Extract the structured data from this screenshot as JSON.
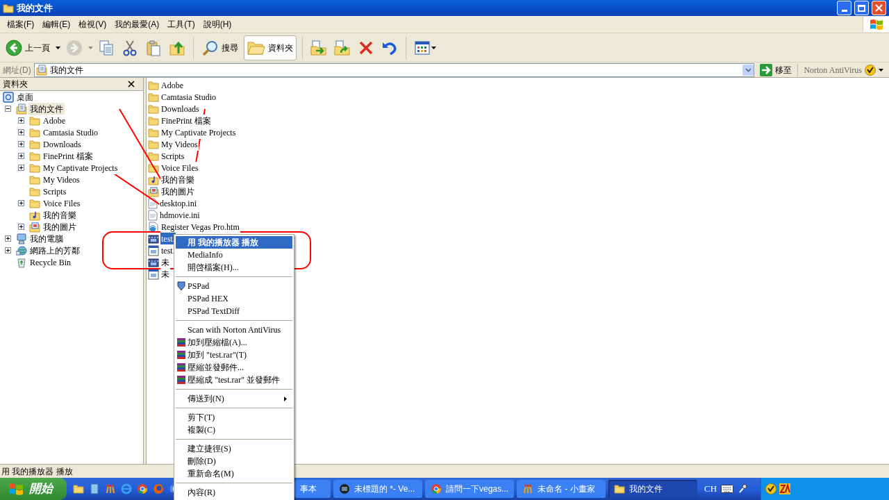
{
  "window": {
    "title": "我的文件"
  },
  "menu_bar": [
    {
      "label": "檔案(F)"
    },
    {
      "label": "編輯(E)"
    },
    {
      "label": "檢視(V)"
    },
    {
      "label": "我的最愛(A)"
    },
    {
      "label": "工具(T)"
    },
    {
      "label": "說明(H)"
    }
  ],
  "toolbar": {
    "back": {
      "label": "上一頁"
    },
    "forward": {
      "disabled": true
    },
    "search": {
      "label": "搜尋"
    },
    "folders": {
      "label": "資料夾",
      "selected": true
    }
  },
  "address_bar": {
    "label": "網址(D)",
    "value": "我的文件",
    "go_button": "移至",
    "norton": "Norton AntiVirus"
  },
  "folder_pane": {
    "title": "資料夾",
    "tree": [
      {
        "label": "桌面",
        "expandable": false,
        "expanded": true,
        "selected": false,
        "children": [
          {
            "label": "我的文件",
            "expandable": true,
            "expanded": true,
            "selected": true,
            "children": [
              {
                "label": "Adobe",
                "expandable": true,
                "expanded": false,
                "selected": false
              },
              {
                "label": "Camtasia Studio",
                "expandable": true,
                "expanded": false,
                "selected": false
              },
              {
                "label": "Downloads",
                "expandable": true,
                "expanded": false,
                "selected": false
              },
              {
                "label": "FinePrint 檔案",
                "expandable": true,
                "expanded": false,
                "selected": false
              },
              {
                "label": "My Captivate Projects",
                "expandable": true,
                "expanded": false,
                "selected": false
              },
              {
                "label": "My Videos",
                "expandable": false,
                "expanded": false,
                "selected": false
              },
              {
                "label": "Scripts",
                "expandable": false,
                "expanded": false,
                "selected": false
              },
              {
                "label": "Voice Files",
                "expandable": true,
                "expanded": false,
                "selected": false
              },
              {
                "label": "我的音樂",
                "expandable": false,
                "expanded": false,
                "selected": false
              },
              {
                "label": "我的圖片",
                "expandable": true,
                "expanded": false,
                "selected": false
              }
            ]
          },
          {
            "label": "我的電腦",
            "expandable": true,
            "expanded": false,
            "selected": false
          },
          {
            "label": "網路上的芳鄰",
            "expandable": true,
            "expanded": false,
            "selected": false
          },
          {
            "label": "Recycle Bin",
            "expandable": false,
            "expanded": false,
            "selected": false
          }
        ]
      }
    ]
  },
  "file_list": [
    {
      "name": "Adobe",
      "selected": false
    },
    {
      "name": "Camtasia Studio",
      "selected": false
    },
    {
      "name": "Downloads",
      "selected": false
    },
    {
      "name": "FinePrint 檔案",
      "selected": false
    },
    {
      "name": "My Captivate Projects",
      "selected": false
    },
    {
      "name": "My Videos",
      "selected": false
    },
    {
      "name": "Scripts",
      "selected": false
    },
    {
      "name": "Voice Files",
      "selected": false
    },
    {
      "name": "我的音樂",
      "selected": false
    },
    {
      "name": "我的圖片",
      "selected": false
    },
    {
      "name": "desktop.ini",
      "selected": false
    },
    {
      "name": "hdmovie.ini",
      "selected": false
    },
    {
      "name": "Register Vegas Pro.htm",
      "selected": false
    },
    {
      "name": "test.",
      "selected": true
    },
    {
      "name": "test.",
      "selected": false
    },
    {
      "name": "未",
      "selected": false
    },
    {
      "name": "未",
      "selected": false
    }
  ],
  "context_menu": [
    {
      "kind": "item",
      "label": "用 我的播放器 播放",
      "default": true,
      "selected": true
    },
    {
      "kind": "item",
      "label": "MediaInfo",
      "selected": false
    },
    {
      "kind": "item",
      "label": "開啓檔案(H)...",
      "selected": false
    },
    {
      "kind": "separator"
    },
    {
      "kind": "item",
      "label": "PSPad",
      "selected": false
    },
    {
      "kind": "item",
      "label": "PSPad HEX",
      "selected": false
    },
    {
      "kind": "item",
      "label": "PSPad TextDiff",
      "selected": false
    },
    {
      "kind": "separator"
    },
    {
      "kind": "item",
      "label": "Scan with Norton AntiVirus",
      "selected": false
    },
    {
      "kind": "item",
      "label": "加到壓縮檔(A)...",
      "selected": false
    },
    {
      "kind": "item",
      "label": "加到 \"test.rar\"(T)",
      "selected": false
    },
    {
      "kind": "item",
      "label": "壓縮並發郵件...",
      "selected": false
    },
    {
      "kind": "item",
      "label": "壓縮成 \"test.rar\" 並發郵件",
      "selected": false
    },
    {
      "kind": "separator"
    },
    {
      "kind": "item",
      "label": "傳送到(N)",
      "submenu": true,
      "selected": false
    },
    {
      "kind": "separator"
    },
    {
      "kind": "item",
      "label": "剪下(T)",
      "selected": false
    },
    {
      "kind": "item",
      "label": "複製(C)",
      "selected": false
    },
    {
      "kind": "separator"
    },
    {
      "kind": "item",
      "label": "建立捷徑(S)",
      "selected": false
    },
    {
      "kind": "item",
      "label": "刪除(D)",
      "selected": false
    },
    {
      "kind": "item",
      "label": "重新命名(M)",
      "selected": false
    },
    {
      "kind": "separator"
    },
    {
      "kind": "item",
      "label": "內容(R)",
      "selected": false
    }
  ],
  "status_bar": "用 我的播放器 播放",
  "taskbar": {
    "start": "開始",
    "tasks": [
      {
        "label": "事本",
        "selected": false
      },
      {
        "label": "未標題的 *- Ve...",
        "selected": false
      },
      {
        "label": "請問一下vegas...",
        "selected": false
      },
      {
        "label": "未命名 - 小畫家",
        "selected": false
      },
      {
        "label": "我的文件",
        "selected": true
      }
    ],
    "language": "CH"
  }
}
